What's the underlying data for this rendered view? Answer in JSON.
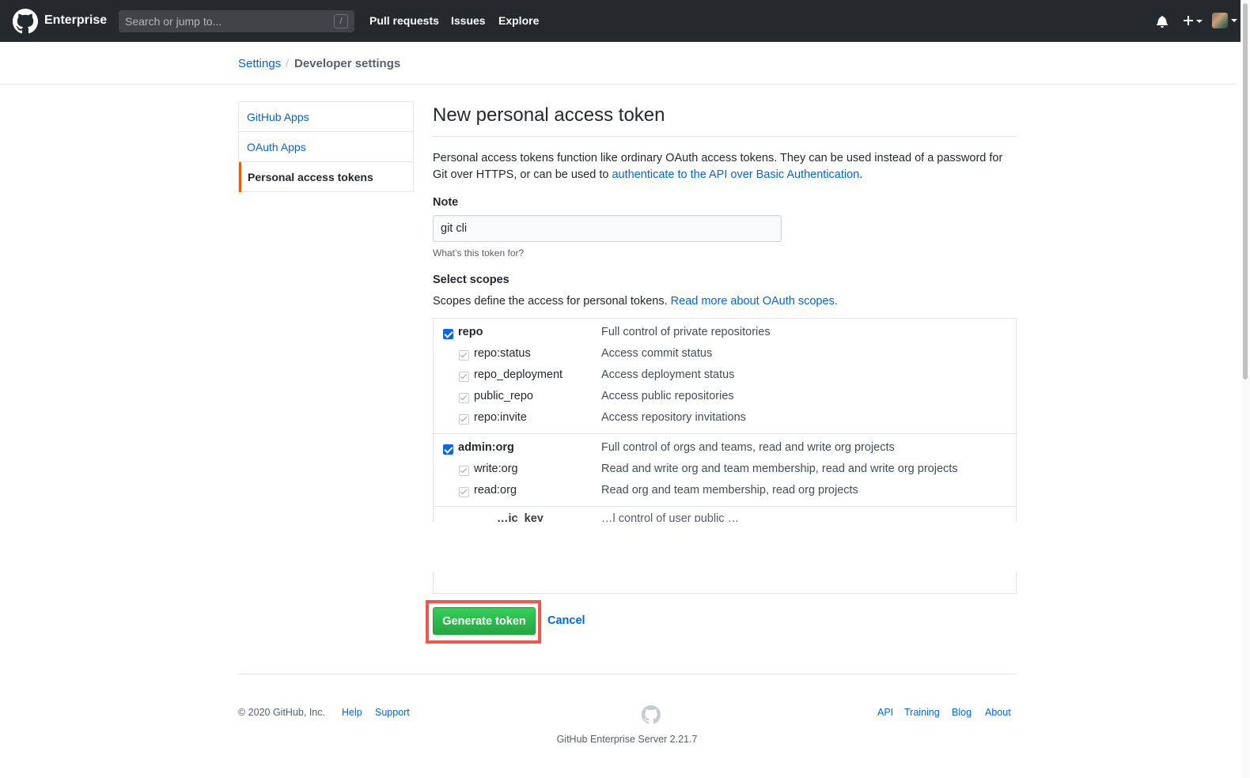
{
  "topbar": {
    "brand": "Enterprise",
    "search_placeholder": "Search or jump to...",
    "search_shortcut": "/",
    "nav": [
      "Pull requests",
      "Issues",
      "Explore"
    ],
    "icons": [
      "github-logo",
      "bell-icon",
      "plus-icon",
      "avatar"
    ]
  },
  "breadcrumb": {
    "root": "Settings",
    "separator": "/",
    "current": "Developer settings"
  },
  "sidebar": {
    "items": [
      {
        "label": "GitHub Apps",
        "selected": false
      },
      {
        "label": "OAuth Apps",
        "selected": false
      },
      {
        "label": "Personal access tokens",
        "selected": true
      }
    ]
  },
  "main": {
    "title": "New personal access token",
    "intro_text": "Personal access tokens function like ordinary OAuth access tokens. They can be used instead of a password for Git over HTTPS, or can be used to ",
    "intro_link": "authenticate to the API over Basic Authentication",
    "intro_end": ".",
    "note_label": "Note",
    "note_value": "git cli",
    "note_help": "What’s this token for?",
    "scopes_label": "Select scopes",
    "scopes_desc": "Scopes define the access for personal tokens. ",
    "scopes_link": "Read more about OAuth scopes.",
    "scope_groups": [
      {
        "name": "repo",
        "desc": "Full control of private repositories",
        "checked": true,
        "children": [
          {
            "name": "repo:status",
            "desc": "Access commit status",
            "checked": true
          },
          {
            "name": "repo_deployment",
            "desc": "Access deployment status",
            "checked": true
          },
          {
            "name": "public_repo",
            "desc": "Access public repositories",
            "checked": true
          },
          {
            "name": "repo:invite",
            "desc": "Access repository invitations",
            "checked": true
          }
        ]
      },
      {
        "name": "admin:org",
        "desc": "Full control of orgs and teams, read and write org projects",
        "checked": true,
        "children": [
          {
            "name": "write:org",
            "desc": "Read and write org and team membership, read and write org projects",
            "checked": true
          },
          {
            "name": "read:org",
            "desc": "Read org and team membership, read org projects",
            "checked": true
          }
        ]
      }
    ],
    "partial_scope": {
      "name": "…ic_key",
      "desc": "…l control of user public …"
    },
    "generate_button": "Generate token",
    "cancel_link": "Cancel",
    "colors": {
      "accent": "#0366d6",
      "primary_button": "#28a745",
      "highlight": "#f0574a",
      "selected_marker": "#e36209"
    }
  },
  "footer": {
    "copyright": "© 2020 GitHub, Inc.",
    "left_links": [
      "Help",
      "Support"
    ],
    "right_links": [
      "API",
      "Training",
      "Blog",
      "About"
    ],
    "version": "GitHub Enterprise Server 2.21.7"
  }
}
